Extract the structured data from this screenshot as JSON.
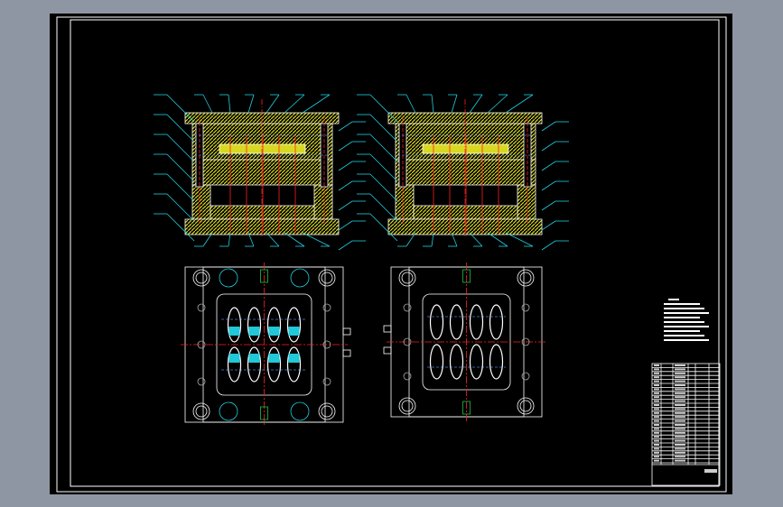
{
  "colors": {
    "background": "#8f96a3",
    "canvas": "#000000",
    "outline": "#ffffff",
    "hatch": "#d8d820",
    "centerline": "#ff2020",
    "leader": "#20d0e0",
    "hidden": "#5080d0",
    "green": "#20c040",
    "magenta": "#e020e0"
  },
  "drawing": {
    "cavity_count": 8,
    "views": [
      "section-a",
      "section-b",
      "moving-half-plan",
      "fixed-half-plan"
    ]
  }
}
